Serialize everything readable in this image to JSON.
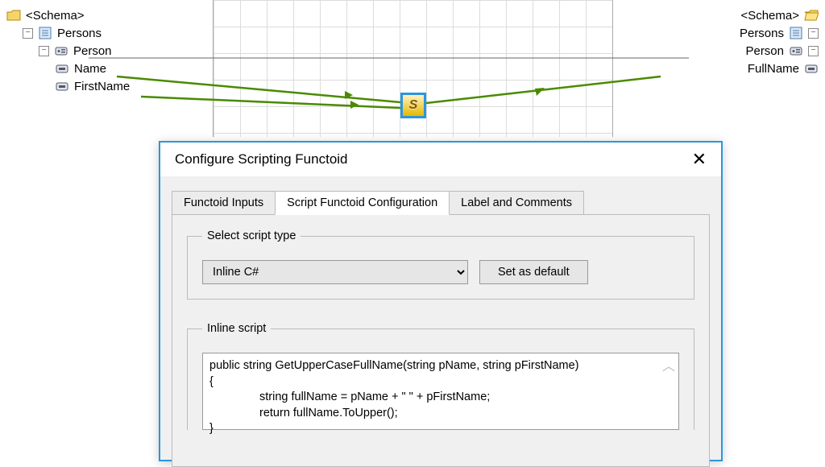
{
  "sourceTree": {
    "schema": "<Schema>",
    "root": "Persons",
    "record": "Person",
    "fields": [
      "Name",
      "FirstName"
    ]
  },
  "destTree": {
    "schema": "<Schema>",
    "root": "Persons",
    "record": "Person",
    "fields": [
      "FullName"
    ]
  },
  "functoid": {
    "glyph": "S"
  },
  "dialog": {
    "title": "Configure Scripting Functoid",
    "tabs": [
      "Functoid Inputs",
      "Script Functoid Configuration",
      "Label and Comments"
    ],
    "activeTab": 1,
    "scriptTypeGroup": "Select script type",
    "scriptType": "Inline C#",
    "setDefault": "Set as default",
    "inlineGroup": "Inline script",
    "code": {
      "l1": "public string GetUpperCaseFullName(string pName, string pFirstName)",
      "l2": "{",
      "l3": "string fullName = pName + \" \" + pFirstName;",
      "l4": "return fullName.ToUpper();",
      "l5": "}"
    }
  }
}
